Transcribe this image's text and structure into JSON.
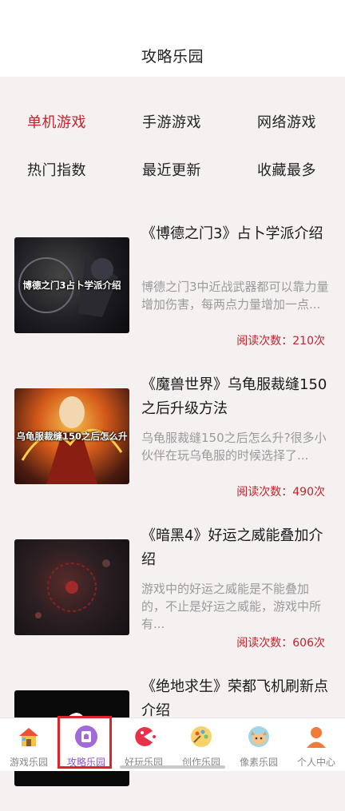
{
  "header": {
    "title": "攻略乐园"
  },
  "filters": {
    "row1": [
      "单机游戏",
      "手游游戏",
      "网络游戏"
    ],
    "row2": [
      "热门指数",
      "最近更新",
      "收藏最多"
    ],
    "active": "单机游戏"
  },
  "articles": [
    {
      "thumb_label": "博德之门3占卜学派介绍",
      "title": "《博德之门3》占卜学派介绍",
      "desc": "博德之门3中近战武器都可以靠力量增加伤害，每两点力量增加一点...",
      "views": "阅读次数：210次"
    },
    {
      "thumb_label": "乌龟服裁缝150之后怎么升",
      "title": "《魔兽世界》乌龟服裁缝150之后升级方法",
      "desc": "乌龟服裁缝150之后怎么升?很多小伙伴在玩乌龟服的时候选择了...",
      "views": "阅读次数：490次"
    },
    {
      "thumb_label": "",
      "title": "《暗黑4》好运之威能叠加介绍",
      "desc": "游戏中的好运之威能是不能叠加的，不止是好运之威能，游戏中所有...",
      "views": "阅读次数：606次"
    },
    {
      "thumb_label": "",
      "title": "《绝地求生》荣都飞机刷新点介绍",
      "desc": "",
      "views": ""
    }
  ],
  "tabbar": {
    "items": [
      {
        "label": "游戏乐园",
        "icon": "house-icon"
      },
      {
        "label": "攻略乐园",
        "icon": "guide-icon"
      },
      {
        "label": "好玩乐园",
        "icon": "pacman-icon"
      },
      {
        "label": "创作乐园",
        "icon": "palette-icon"
      },
      {
        "label": "像素乐园",
        "icon": "pixel-cat-icon"
      },
      {
        "label": "个人中心",
        "icon": "person-icon"
      }
    ],
    "active_index": 1
  },
  "colors": {
    "accent": "#c8202a",
    "tab_active": "#8a56c8",
    "highlight_box": "#e0232b"
  }
}
